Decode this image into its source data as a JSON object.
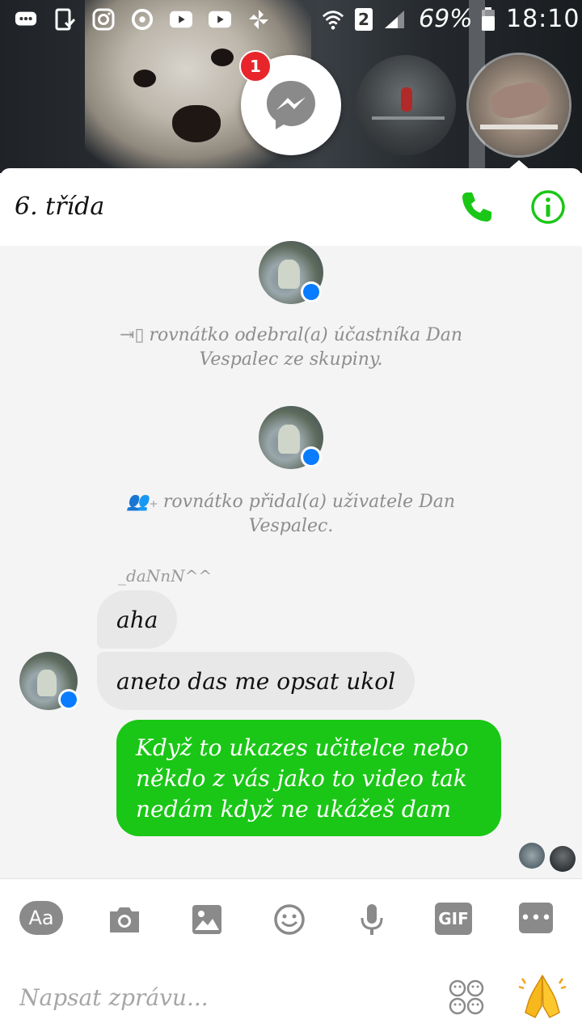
{
  "status_bar": {
    "battery": "69%",
    "time": "18:10",
    "sim": "2"
  },
  "chat_heads": {
    "unread_badge": "1"
  },
  "header": {
    "title": "6. třída"
  },
  "events": [
    {
      "text": "rovnátko odebral(a) účastníka Dan Vespalec ze skupiny."
    },
    {
      "text": "rovnátko přidal(a) uživatele Dan Vespalec."
    }
  ],
  "messages": {
    "sender_name": "_daNnN^^",
    "incoming": [
      "aha",
      "aneto das me opsat ukol"
    ],
    "outgoing": "Když to ukazes učitelce nebo někdo z vás jako to video tak nedám když ne ukážeš dam"
  },
  "composer": {
    "aa_label": "Aa",
    "gif_label": "GIF",
    "placeholder": "Napsat zprávu..."
  },
  "colors": {
    "accent_green": "#1ac716",
    "messenger_blue": "#0a7cff",
    "badge_red": "#e8252b"
  }
}
